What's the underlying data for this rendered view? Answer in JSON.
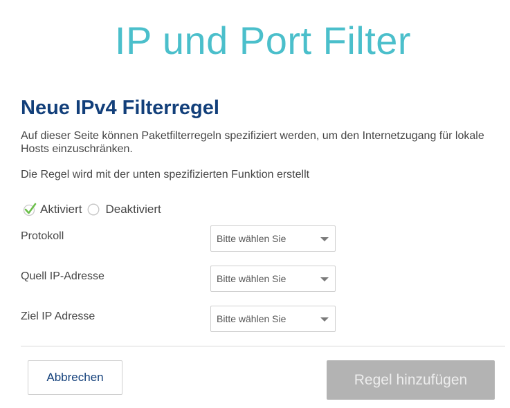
{
  "page_title": "IP und Port Filter",
  "section_title": "Neue IPv4 Filterregel",
  "description": "Auf dieser Seite können Paketfilterregeln spezifiziert werden, um den Internetzugang für lokale Hosts einzuschränken.",
  "description2": "Die Regel wird mit der unten spezifizierten Funktion erstellt",
  "status": {
    "activated_label": "Aktiviert",
    "deactivated_label": "Deaktiviert",
    "selected": "Aktiviert",
    "check_color": "#6cbf4b"
  },
  "fields": [
    {
      "label": "Protokoll",
      "value": "Bitte wählen Sie"
    },
    {
      "label": "Quell IP-Adresse",
      "value": "Bitte wählen Sie"
    },
    {
      "label": "Ziel IP Adresse",
      "value": "Bitte wählen Sie"
    }
  ],
  "buttons": {
    "cancel": "Abbrechen",
    "add": "Regel hinzufügen"
  },
  "colors": {
    "title": "#4bbfcb",
    "heading": "#123f7a",
    "disabled_button": "#b3b3b3"
  }
}
